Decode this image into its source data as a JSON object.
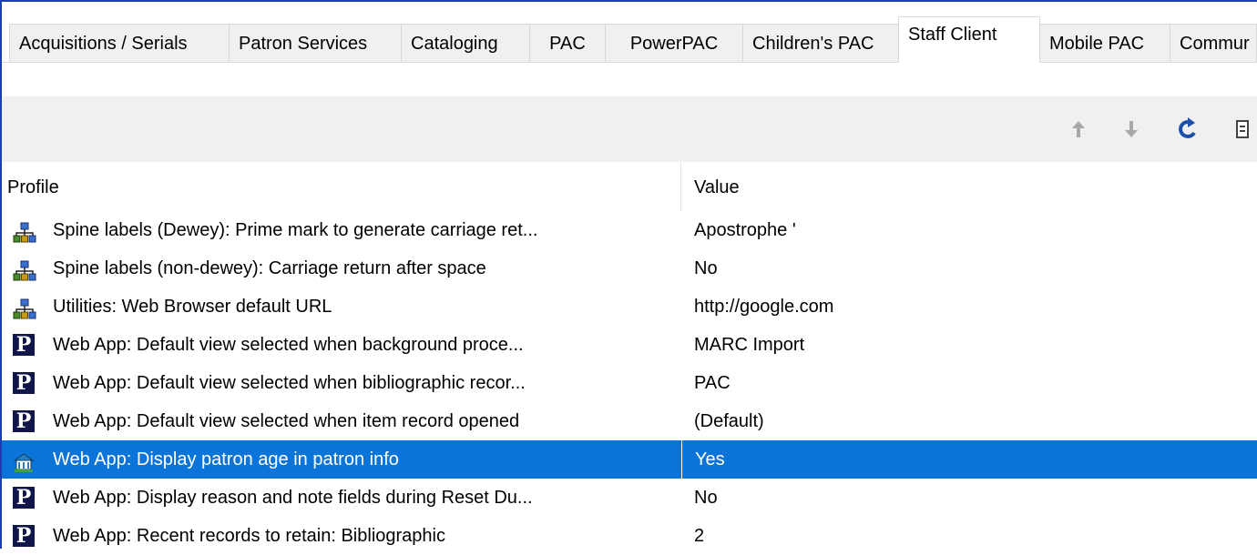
{
  "tabs": [
    {
      "label": "Acquisitions / Serials"
    },
    {
      "label": "Patron Services"
    },
    {
      "label": "Cataloging"
    },
    {
      "label": "PAC"
    },
    {
      "label": "PowerPAC"
    },
    {
      "label": "Children's PAC"
    },
    {
      "label": "Staff Client",
      "active": true
    },
    {
      "label": "Mobile PAC"
    },
    {
      "label": "Commur"
    }
  ],
  "toolbar": {
    "icons": [
      "arrow-up-icon",
      "arrow-down-icon",
      "refresh-icon",
      "export-icon"
    ]
  },
  "grid": {
    "headers": {
      "profile": "Profile",
      "value": "Value"
    },
    "rows": [
      {
        "icon": "network-icon",
        "profile": "Spine labels (Dewey): Prime mark to generate carriage ret...",
        "value": "Apostrophe '"
      },
      {
        "icon": "network-icon",
        "profile": "Spine labels (non-dewey): Carriage return after space",
        "value": "No"
      },
      {
        "icon": "network-icon",
        "profile": "Utilities: Web Browser default URL",
        "value": "http://google.com"
      },
      {
        "icon": "polaris-p-icon",
        "profile": "Web App: Default view selected when background proce...",
        "value": "MARC Import"
      },
      {
        "icon": "polaris-p-icon",
        "profile": "Web App: Default view selected when bibliographic recor...",
        "value": "PAC"
      },
      {
        "icon": "polaris-p-icon",
        "profile": "Web App: Default view selected when item record opened",
        "value": "(Default)"
      },
      {
        "icon": "library-icon",
        "profile": "Web App: Display patron age in patron info",
        "value": "Yes",
        "selected": true
      },
      {
        "icon": "polaris-p-icon",
        "profile": "Web App: Display reason and note fields during Reset Du...",
        "value": "No"
      },
      {
        "icon": "polaris-p-icon",
        "profile": "Web App: Recent records to retain: Bibliographic",
        "value": "2"
      }
    ]
  },
  "colors": {
    "selection": "#0b74d8",
    "border": "#1c3fb0",
    "toolbar": "#f0f0f0"
  }
}
